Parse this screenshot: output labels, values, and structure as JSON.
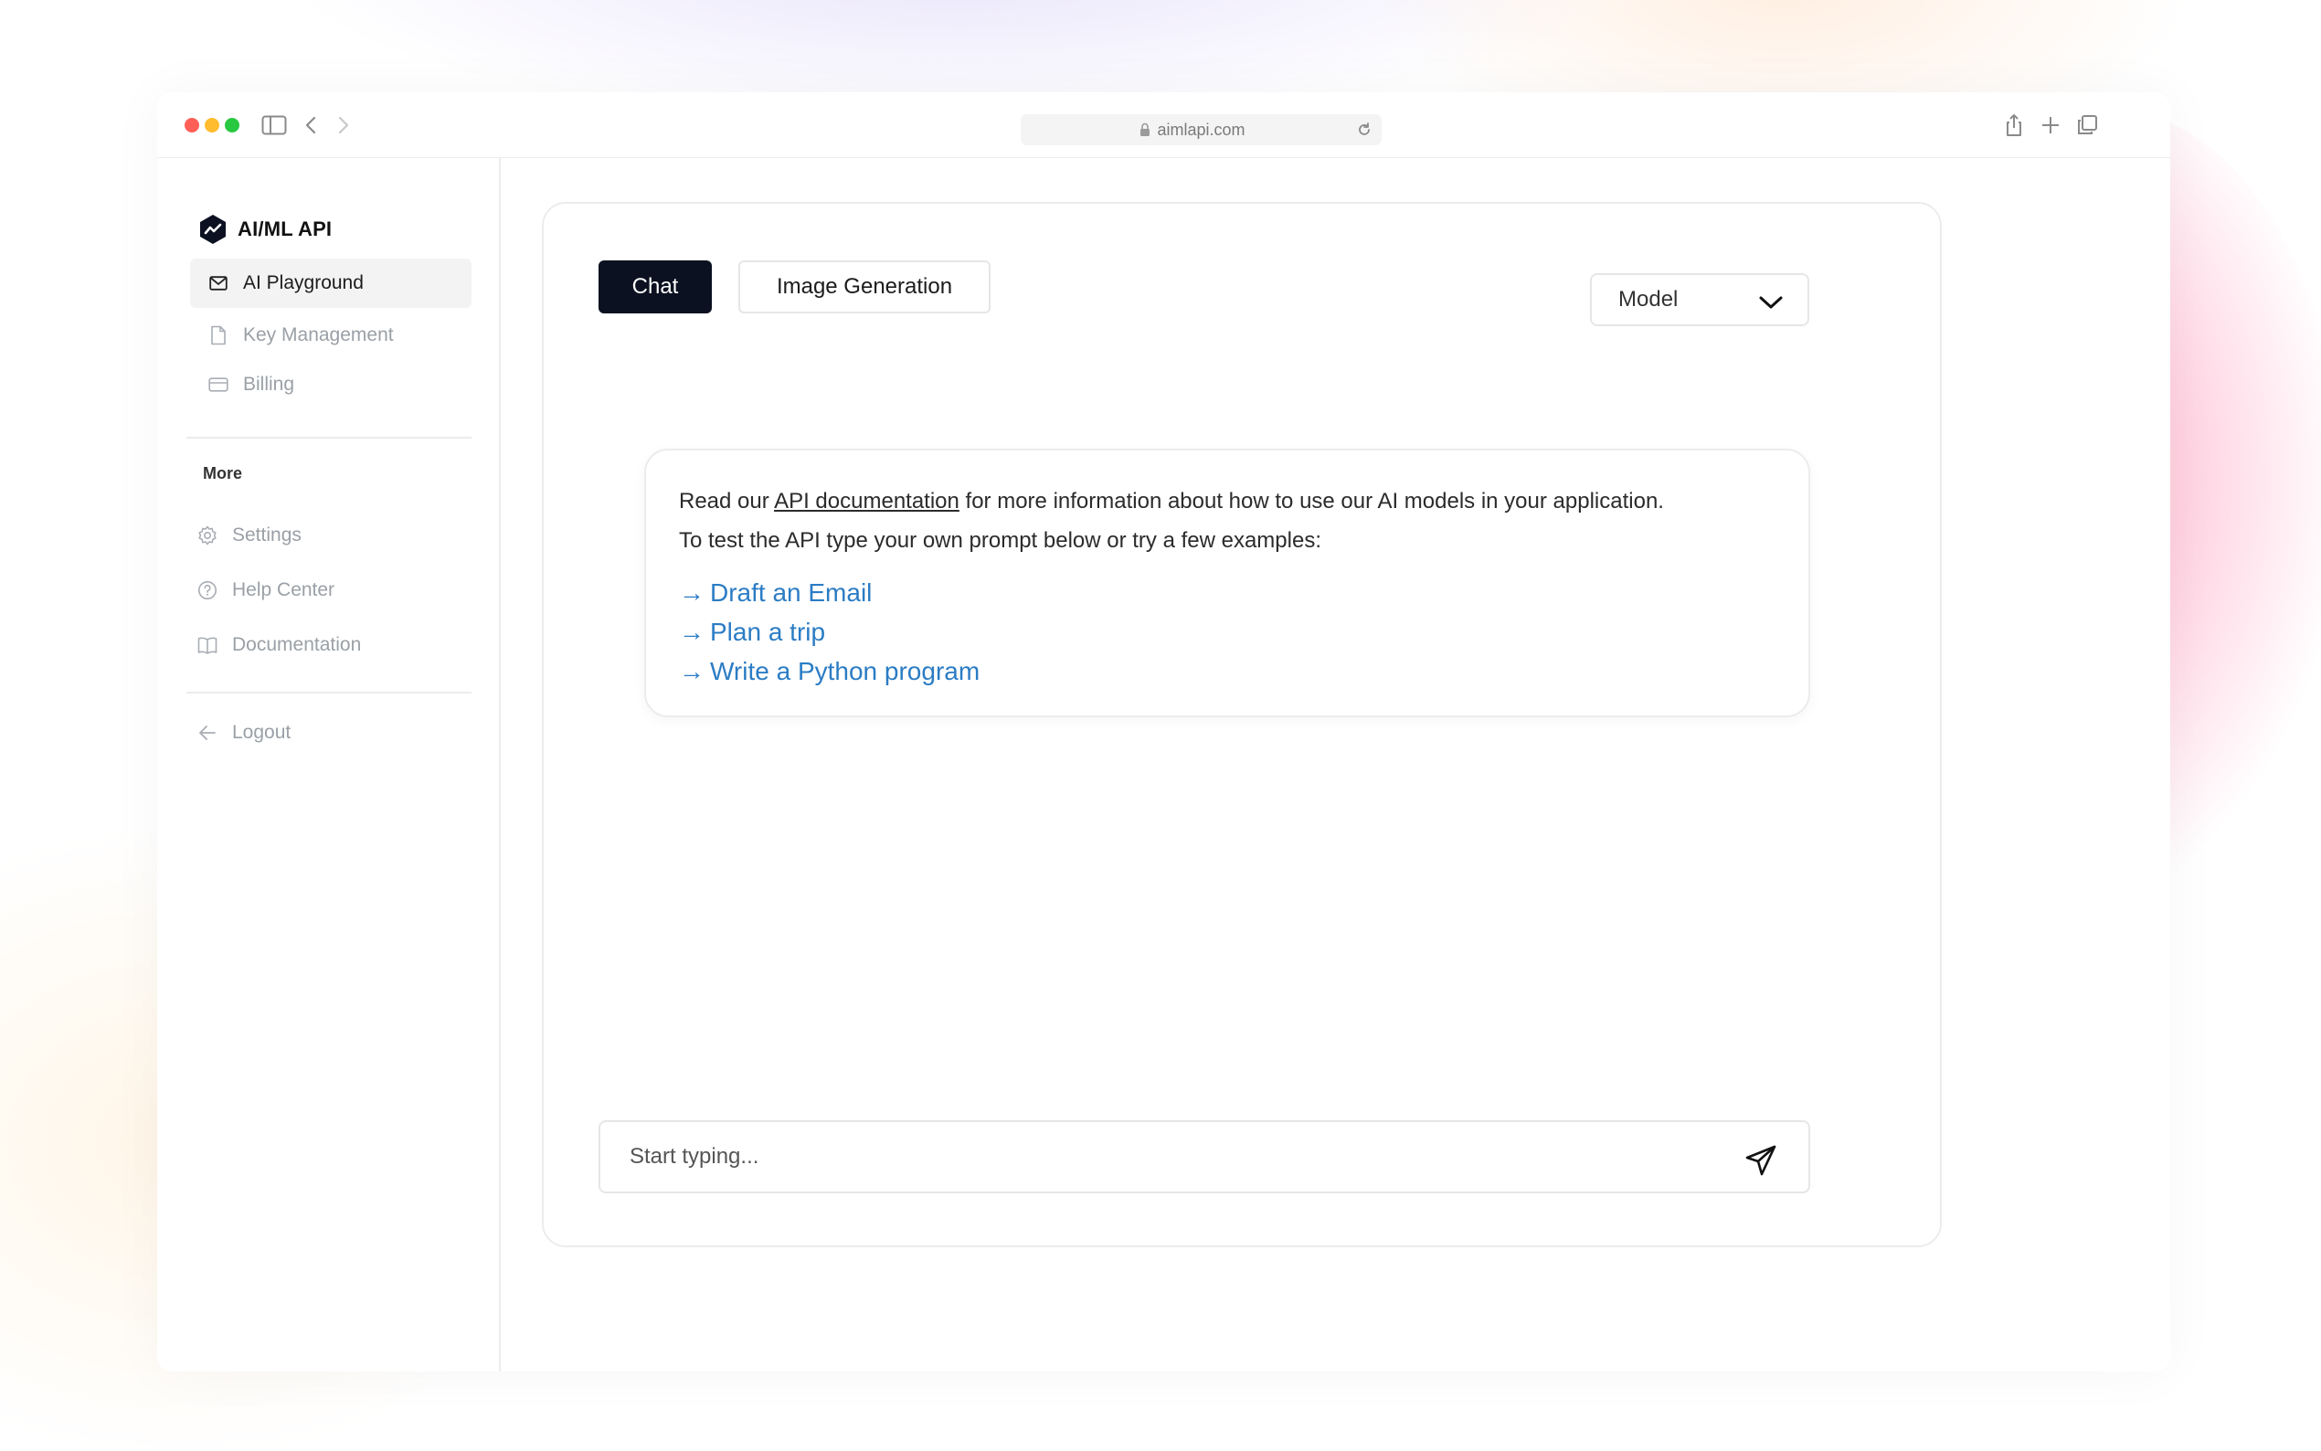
{
  "browser": {
    "url": "aimlapi.com"
  },
  "sidebar": {
    "brand": "AI/ML API",
    "primary_items": [
      {
        "label": "AI Playground",
        "icon": "mail-icon",
        "active": true
      },
      {
        "label": "Key Management",
        "icon": "document-icon",
        "active": false
      },
      {
        "label": "Billing",
        "icon": "credit-card-icon",
        "active": false
      }
    ],
    "more_label": "More",
    "more_items": [
      {
        "label": "Settings",
        "icon": "gear-icon"
      },
      {
        "label": "Help Center",
        "icon": "help-circle-icon"
      },
      {
        "label": "Documentation",
        "icon": "book-icon"
      }
    ],
    "logout_label": "Logout"
  },
  "main": {
    "tabs": [
      {
        "label": "Chat",
        "active": true
      },
      {
        "label": "Image Generation",
        "active": false
      }
    ],
    "model_select": {
      "value": "Model"
    },
    "info": {
      "line1_prefix": "Read our ",
      "line1_link": "API documentation",
      "line1_suffix": " for more information about how to use our AI models in your application.",
      "line2": "To test the API type your own prompt below or try a few examples:",
      "examples": [
        "Draft an Email",
        "Plan a trip",
        "Write a Python program"
      ]
    },
    "input": {
      "placeholder": "Start typing...",
      "value": ""
    }
  },
  "colors": {
    "accent_dark": "#0b1120",
    "link_blue": "#2b7cc4"
  }
}
